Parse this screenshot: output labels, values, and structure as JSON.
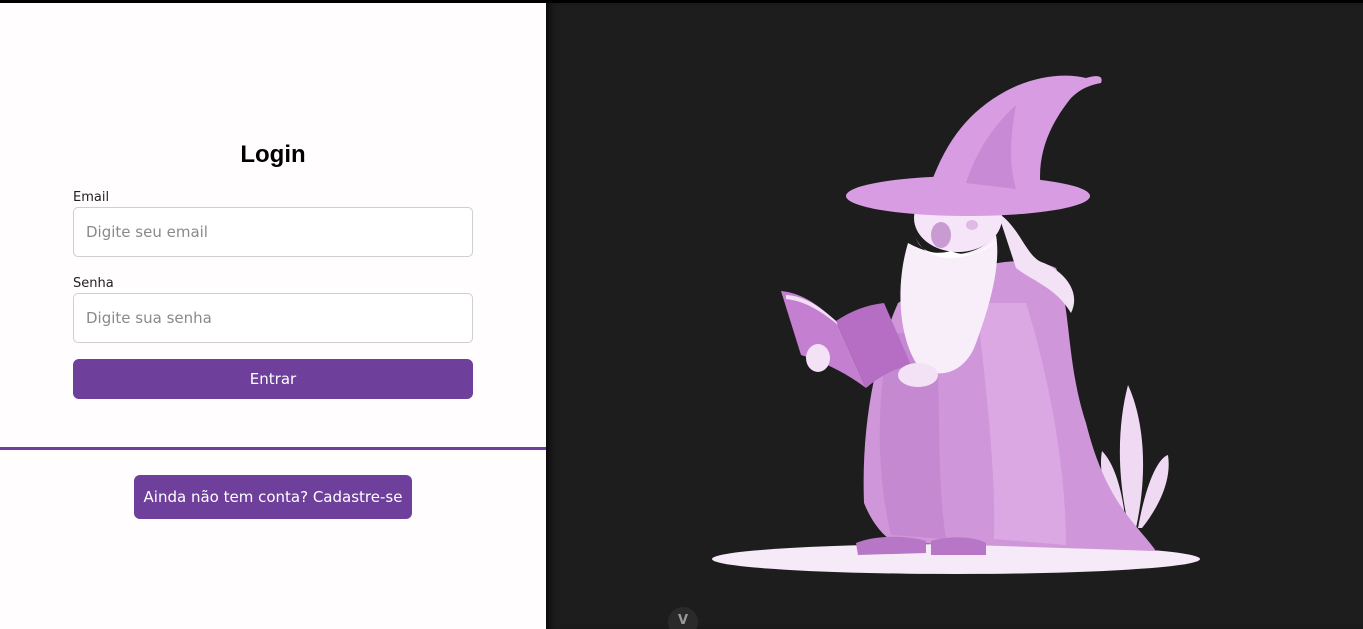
{
  "login": {
    "title": "Login",
    "email_label": "Email",
    "email_placeholder": "Digite seu email",
    "email_value": "",
    "password_label": "Senha",
    "password_placeholder": "Digite sua senha",
    "password_value": "",
    "submit_label": "Entrar",
    "signup_label": "Ainda não tem conta? Cadastre-se"
  },
  "illustration": {
    "subject": "wizard-reading-book",
    "accent_color": "#d7a1e2"
  },
  "devtools": {
    "icon": "vue-logo-icon",
    "glyph": "V"
  },
  "colors": {
    "primary": "#6e3f9b",
    "panel_left_bg": "#fffdfe",
    "panel_right_bg": "#1e1d1e"
  }
}
